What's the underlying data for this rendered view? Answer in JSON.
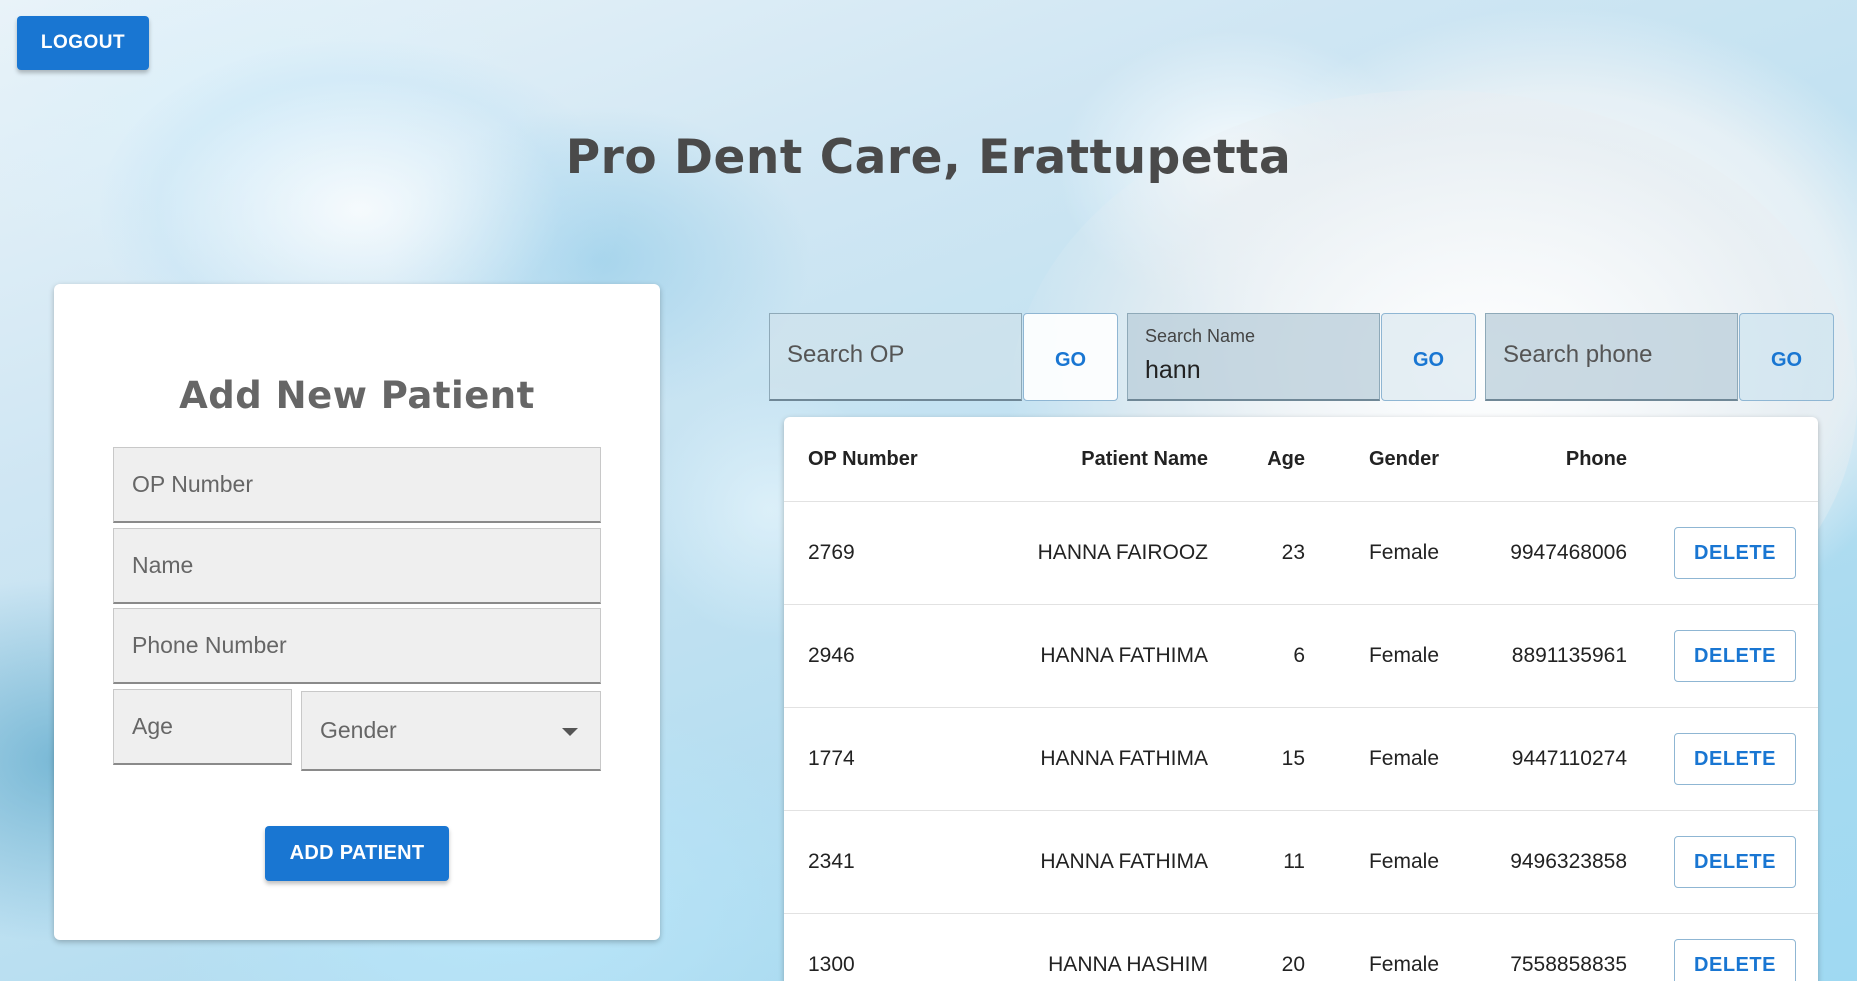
{
  "header": {
    "logout_label": "LOGOUT",
    "title": "Pro Dent Care, Erattupetta"
  },
  "add_patient_form": {
    "heading": "Add New Patient",
    "op_number_placeholder": "OP Number",
    "name_placeholder": "Name",
    "phone_placeholder": "Phone Number",
    "age_placeholder": "Age",
    "gender_placeholder": "Gender",
    "submit_label": "ADD PATIENT"
  },
  "search": {
    "op": {
      "placeholder": "Search OP",
      "go_label": "GO"
    },
    "name": {
      "label": "Search Name",
      "value": "hann",
      "go_label": "GO"
    },
    "phone": {
      "placeholder": "Search phone",
      "go_label": "GO"
    }
  },
  "table": {
    "columns": [
      "OP Number",
      "Patient Name",
      "Age",
      "Gender",
      "Phone"
    ],
    "delete_label": "DELETE",
    "rows": [
      {
        "op": "2769",
        "name": "HANNA FAIROOZ",
        "age": "23",
        "gender": "Female",
        "phone": "9947468006"
      },
      {
        "op": "2946",
        "name": "HANNA FATHIMA",
        "age": "6",
        "gender": "Female",
        "phone": "8891135961"
      },
      {
        "op": "1774",
        "name": "HANNA FATHIMA",
        "age": "15",
        "gender": "Female",
        "phone": "9447110274"
      },
      {
        "op": "2341",
        "name": "HANNA FATHIMA",
        "age": "11",
        "gender": "Female",
        "phone": "9496323858"
      },
      {
        "op": "1300",
        "name": "HANNA HASHIM",
        "age": "20",
        "gender": "Female",
        "phone": "7558858835"
      }
    ]
  },
  "colors": {
    "primary": "#1976d2",
    "title_text": "#4a4a4a",
    "card_background": "#ffffff"
  }
}
